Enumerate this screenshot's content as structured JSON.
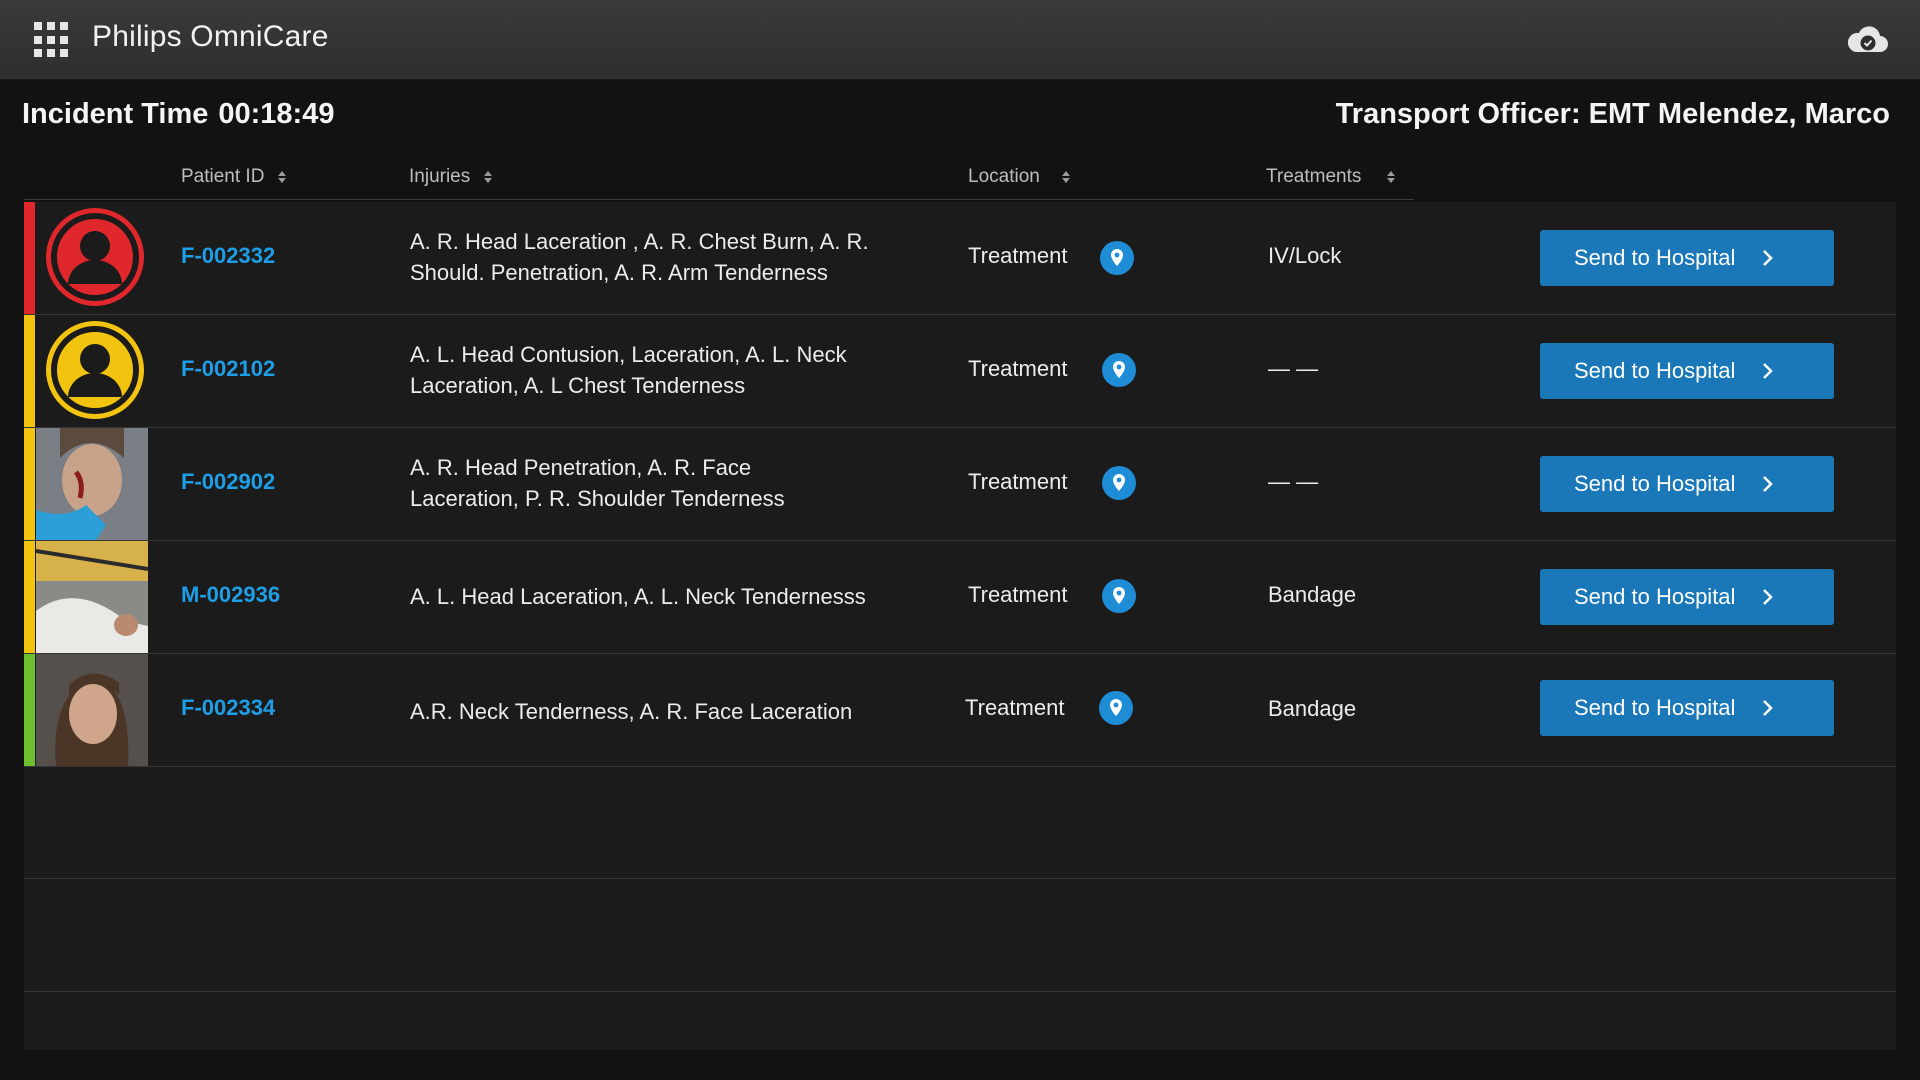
{
  "app": {
    "title": "Philips OmniCare"
  },
  "incident": {
    "label": "Incident Time",
    "time": "00:18:49"
  },
  "officer": {
    "text": "Transport Officer: EMT Melendez, Marco"
  },
  "columns": {
    "patient_id": "Patient ID",
    "injuries": "Injuries",
    "location": "Location",
    "treatments": "Treatments"
  },
  "colors": {
    "red": "#e0272b",
    "yellow": "#f2c40f",
    "green": "#6cbf2f",
    "accent": "#1e9ee6",
    "button": "#1a78b8"
  },
  "patients": [
    {
      "triage": "red",
      "thumb": "person-icon",
      "id": "F-002332",
      "injuries_line1": "A. R. Head Laceration , A. R. Chest Burn, A. R.",
      "injuries_line2": "Should. Penetration, A. R. Arm Tenderness",
      "location": "Treatment",
      "treatments": "IV/Lock",
      "action": "Send to Hospital"
    },
    {
      "triage": "yellow",
      "thumb": "person-icon",
      "id": "F-002102",
      "injuries_line1": "A. L. Head Contusion, Laceration, A. L. Neck",
      "injuries_line2": "Laceration, A. L Chest Tenderness",
      "location": "Treatment",
      "treatments": "— —",
      "action": "Send to Hospital"
    },
    {
      "triage": "yellow",
      "thumb": "patient-photo",
      "id": "F-002902",
      "injuries_line1": "A. R. Head Penetration, A. R. Face",
      "injuries_line2": "Laceration, P. R. Shoulder Tenderness",
      "location": "Treatment",
      "treatments": "— —",
      "action": "Send to Hospital"
    },
    {
      "triage": "yellow",
      "thumb": "patient-photo",
      "id": "M-002936",
      "injuries_line1": "A. L. Head Laceration, A. L. Neck Tendernesss",
      "location": "Treatment",
      "treatments": "Bandage",
      "action": "Send to Hospital"
    },
    {
      "triage": "green",
      "thumb": "patient-photo",
      "id": "F-002334",
      "injuries_line1": "A.R. Neck Tenderness, A. R. Face Laceration",
      "location": "Treatment",
      "treatments": "Bandage",
      "action": "Send to Hospital"
    }
  ]
}
